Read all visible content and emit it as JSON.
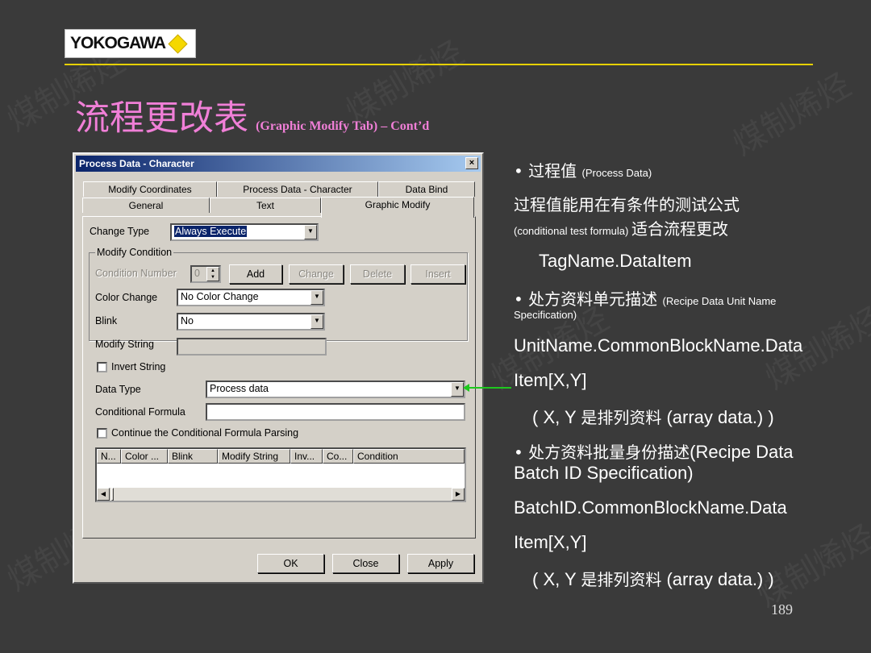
{
  "logo": {
    "text": "YOKOGAWA"
  },
  "title": {
    "main": "流程更改表",
    "sub": "(Graphic Modify Tab) – Cont’d"
  },
  "dialog": {
    "title": "Process Data - Character",
    "close": "×",
    "tabs_back": [
      "Modify Coordinates",
      "Process Data - Character",
      "Data Bind"
    ],
    "tabs_front": [
      "General",
      "Text",
      "Graphic Modify"
    ],
    "change_type_label": "Change Type",
    "change_type_value": "Always Execute",
    "modify_condition_label": "Modify Condition",
    "condition_number_label": "Condition Number",
    "condition_number_value": "0",
    "btn_add": "Add",
    "btn_change": "Change",
    "btn_delete": "Delete",
    "btn_insert": "Insert",
    "color_change_label": "Color Change",
    "color_change_value": "No Color Change",
    "blink_label": "Blink",
    "blink_value": "No",
    "modify_string_label": "Modify String",
    "invert_string_label": "Invert String",
    "data_type_label": "Data Type",
    "data_type_value": "Process data",
    "conditional_formula_label": "Conditional Formula",
    "continue_label": "Continue the Conditional Formula Parsing",
    "grid_headers": [
      "N...",
      "Color ...",
      "Blink",
      "Modify String",
      "Inv...",
      "Co...",
      "Condition"
    ],
    "btn_ok": "OK",
    "btn_close": "Close",
    "btn_apply": "Apply"
  },
  "notes": {
    "b1_cn": "• 过程值 ",
    "b1_en": "(Process Data)",
    "l2": "过程值能用在有条件的测试公式",
    "l3_en": "(conditional test formula) ",
    "l3_cn": "适合流程更改",
    "l4": "TagName.DataItem",
    "b2_cn": "• 处方资料单元描述 ",
    "b2_en": "(Recipe Data Unit Name",
    "b2_en2": "Specification)",
    "l6": "UnitName.CommonBlockName.Data",
    "l7": "Item[X,Y]",
    "l8a": "( X, Y ",
    "l8b": "是排列资料",
    "l8c": " (array data.) )",
    "b3_cn": "• 处方资料批量身份描述",
    "b3_en": "(Recipe Data",
    "b3_en2": "Batch ID Specification)",
    "l10": "BatchID.CommonBlockName.Data",
    "l11": "Item[X,Y]",
    "l12a": "( X, Y ",
    "l12b": "是排列资料",
    "l12c": " (array data.) )"
  },
  "page_number": "189"
}
